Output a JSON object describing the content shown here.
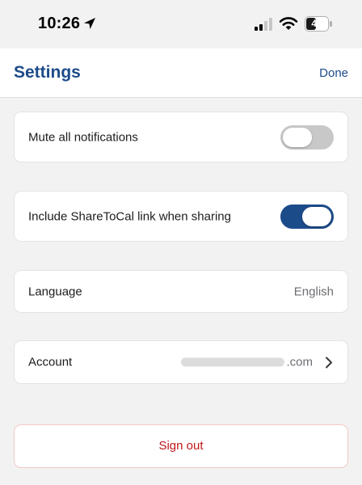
{
  "status_bar": {
    "time": "10:26",
    "battery_level": "44"
  },
  "nav": {
    "title": "Settings",
    "done_label": "Done"
  },
  "settings": {
    "mute": {
      "label": "Mute all notifications",
      "enabled": false
    },
    "include_link": {
      "label": "Include ShareToCal link when sharing",
      "enabled": true
    },
    "language": {
      "label": "Language",
      "value": "English"
    },
    "account": {
      "label": "Account",
      "domain": ".com"
    }
  },
  "sign_out_label": "Sign out",
  "colors": {
    "accent": "#1c4b8a",
    "destructive": "#c0171a",
    "background": "#f2f2f2"
  }
}
